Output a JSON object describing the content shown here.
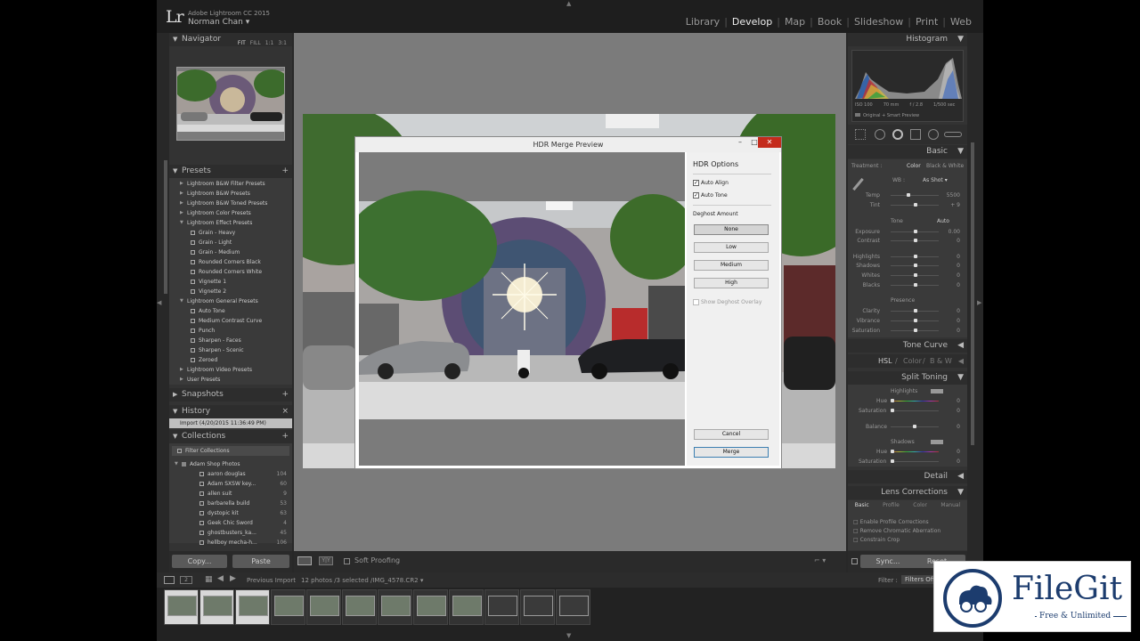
{
  "app": {
    "logo": "Lr",
    "product": "Adobe Lightroom CC 2015",
    "user": "Norman Chan"
  },
  "modules": [
    "Library",
    "Develop",
    "Map",
    "Book",
    "Slideshow",
    "Print",
    "Web"
  ],
  "active_module": "Develop",
  "navigator": {
    "title": "Navigator",
    "zoom_options": [
      "FIT",
      "FILL",
      "1:1",
      "3:1"
    ],
    "active_zoom": "FIT"
  },
  "presets": {
    "title": "Presets",
    "items": [
      {
        "label": "Lightroom B&W Filter Presets",
        "type": "folder"
      },
      {
        "label": "Lightroom B&W Presets",
        "type": "folder"
      },
      {
        "label": "Lightroom B&W Toned Presets",
        "type": "folder"
      },
      {
        "label": "Lightroom Color Presets",
        "type": "folder"
      },
      {
        "label": "Lightroom Effect Presets",
        "type": "folder-open"
      },
      {
        "label": "Grain - Heavy",
        "type": "preset"
      },
      {
        "label": "Grain - Light",
        "type": "preset"
      },
      {
        "label": "Grain - Medium",
        "type": "preset"
      },
      {
        "label": "Rounded Corners Black",
        "type": "preset"
      },
      {
        "label": "Rounded Corners White",
        "type": "preset"
      },
      {
        "label": "Vignette 1",
        "type": "preset"
      },
      {
        "label": "Vignette 2",
        "type": "preset"
      },
      {
        "label": "Lightroom General Presets",
        "type": "folder-open"
      },
      {
        "label": "Auto Tone",
        "type": "preset"
      },
      {
        "label": "Medium Contrast Curve",
        "type": "preset"
      },
      {
        "label": "Punch",
        "type": "preset"
      },
      {
        "label": "Sharpen - Faces",
        "type": "preset"
      },
      {
        "label": "Sharpen - Scenic",
        "type": "preset"
      },
      {
        "label": "Zeroed",
        "type": "preset"
      },
      {
        "label": "Lightroom Video Presets",
        "type": "folder"
      },
      {
        "label": "User Presets",
        "type": "folder"
      }
    ]
  },
  "snapshots": {
    "title": "Snapshots"
  },
  "history": {
    "title": "History",
    "entry": "Import (4/20/2015 11:36:49 PM)"
  },
  "collections": {
    "title": "Collections",
    "filter": "Filter Collections",
    "set": "Adam Shop Photos",
    "items": [
      {
        "label": "aaron douglas",
        "count": "104"
      },
      {
        "label": "Adam SXSW key...",
        "count": "60"
      },
      {
        "label": "allen suit",
        "count": "9"
      },
      {
        "label": "barbarella build",
        "count": "53"
      },
      {
        "label": "dystopic kit",
        "count": "63"
      },
      {
        "label": "Geek Chic Sword",
        "count": "4"
      },
      {
        "label": "ghostbusters_ka...",
        "count": "45"
      },
      {
        "label": "hellboy mecha-h...",
        "count": "106"
      }
    ]
  },
  "left_buttons": {
    "copy": "Copy...",
    "paste": "Paste"
  },
  "toolbar": {
    "soft_proofing": "Soft Proofing"
  },
  "dialog": {
    "title": "HDR Merge Preview",
    "options_title": "HDR Options",
    "auto_align": "Auto Align",
    "auto_tone": "Auto Tone",
    "auto_align_checked": true,
    "auto_tone_checked": true,
    "deghost_label": "Deghost Amount",
    "deghost_options": [
      "None",
      "Low",
      "Medium",
      "High"
    ],
    "deghost_selected": "None",
    "show_overlay": "Show Deghost Overlay",
    "cancel": "Cancel",
    "merge": "Merge"
  },
  "right_panel": {
    "histogram": "Histogram",
    "exif": [
      "ISO 100",
      "70 mm",
      "f / 2.8",
      "1/500 sec"
    ],
    "preview_note": "Original + Smart Preview",
    "basic": "Basic",
    "treatment_label": "Treatment :",
    "treatment_color": "Color",
    "treatment_bw": "Black & White",
    "wb_label": "WB :",
    "wb_value": "As Shot",
    "temp": {
      "label": "Temp",
      "value": "5500"
    },
    "tint": {
      "label": "Tint",
      "value": "+ 9"
    },
    "tone_label": "Tone",
    "tone_auto": "Auto",
    "tone_sliders": [
      {
        "label": "Exposure",
        "value": "0.00"
      },
      {
        "label": "Contrast",
        "value": "0"
      },
      {
        "label": "Highlights",
        "value": "0"
      },
      {
        "label": "Shadows",
        "value": "0"
      },
      {
        "label": "Whites",
        "value": "0"
      },
      {
        "label": "Blacks",
        "value": "0"
      }
    ],
    "presence_label": "Presence",
    "presence_sliders": [
      {
        "label": "Clarity",
        "value": "0"
      },
      {
        "label": "Vibrance",
        "value": "0"
      },
      {
        "label": "Saturation",
        "value": "0"
      }
    ],
    "tone_curve": "Tone Curve",
    "hsl": "HSL",
    "color_tab": "Color",
    "bw_tab": "B & W",
    "split_toning": "Split Toning",
    "highlights": "Highlights",
    "shadows": "Shadows",
    "hue": "Hue",
    "saturation": "Saturation",
    "balance": "Balance",
    "split_hl_hue": "0",
    "split_hl_sat": "0",
    "split_balance": "0",
    "split_sh_hue": "0",
    "split_sh_sat": "0",
    "detail": "Detail",
    "lens_corrections": "Lens Corrections",
    "lens_tabs": [
      "Basic",
      "Profile",
      "Color",
      "Manual"
    ],
    "lens_options": [
      "Enable Profile Corrections",
      "Remove Chromatic Aberration",
      "Constrain Crop"
    ],
    "sync": "Sync...",
    "reset": "Reset"
  },
  "filmstrip": {
    "source_label": "Previous Import",
    "info": "12 photos /3 selected /IMG_4578.CR2",
    "filter_label": "Filter :",
    "filter_value": "Filters Off",
    "thumb_count": 12,
    "selected_count": 3
  },
  "watermark": {
    "title": "FileGit",
    "subtitle": "Free & Unlimited"
  }
}
